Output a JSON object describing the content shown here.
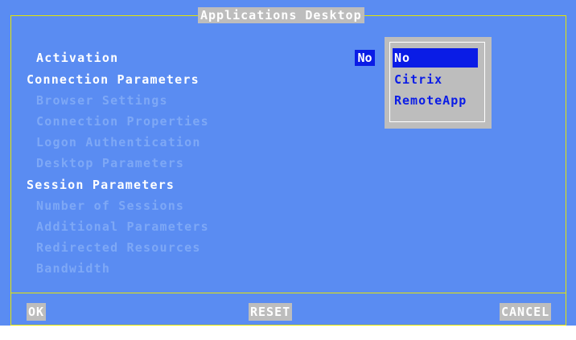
{
  "window": {
    "title": "Applications Desktop"
  },
  "menu": {
    "activation_label": "Activation",
    "connection_parameters": "Connection Parameters",
    "browser_settings": "Browser Settings",
    "connection_properties": "Connection Properties",
    "logon_authentication": "Logon Authentication",
    "desktop_parameters": "Desktop Parameters",
    "session_parameters": "Session Parameters",
    "number_of_sessions": "Number of Sessions",
    "additional_parameters": "Additional Parameters",
    "redirected_resources": "Redirected Resources",
    "bandwidth": "Bandwidth"
  },
  "activation_value": "No",
  "dropdown": {
    "options": [
      "No",
      "Citrix",
      "RemoteApp"
    ],
    "selected": "No"
  },
  "buttons": {
    "ok": "OK",
    "reset": "RESET",
    "cancel": "CANCEL"
  },
  "colors": {
    "background": "#5a8cf2",
    "border": "#e6e600",
    "selection": "#0a1ce6",
    "button_face": "#bdbdbd",
    "disabled_text": "#7ea8f6"
  }
}
